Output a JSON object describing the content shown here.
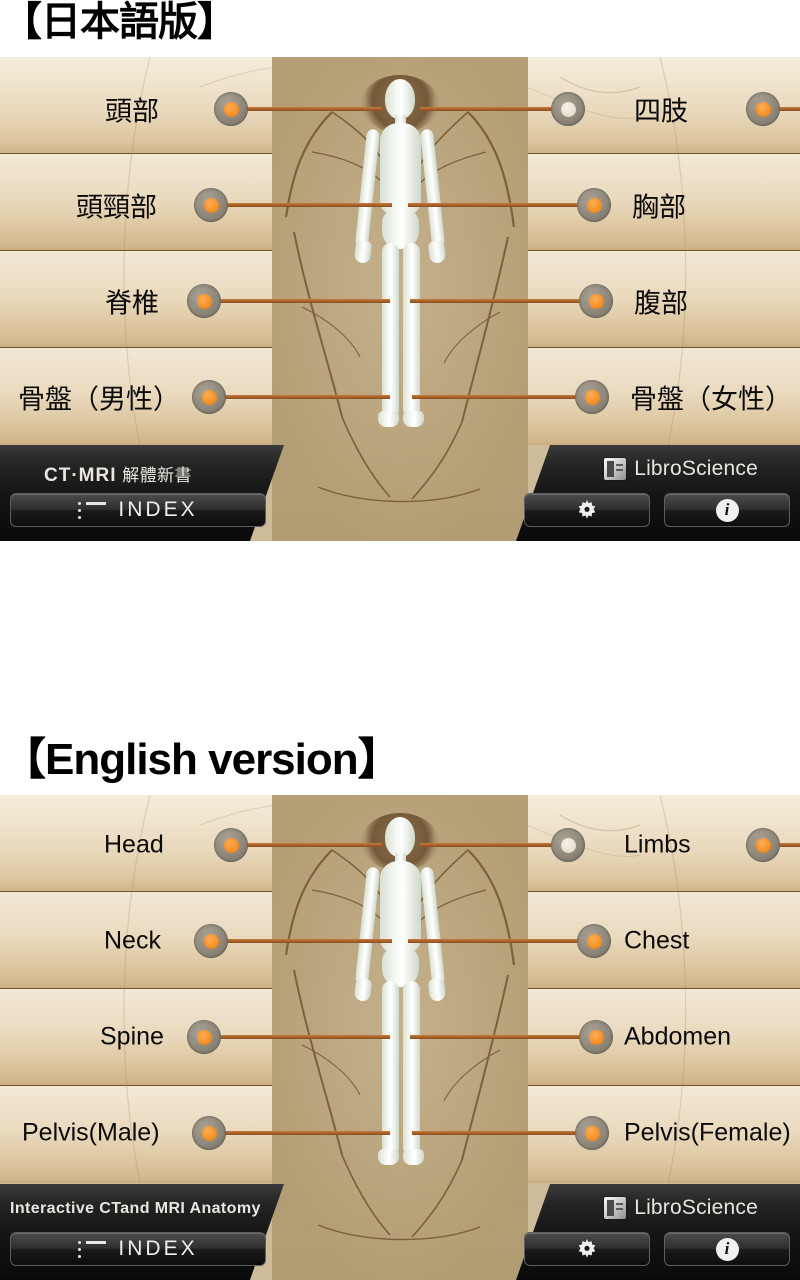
{
  "page": {
    "jp_heading": "【日本語版】",
    "en_heading": "【English version】"
  },
  "app_jp": {
    "language": "Japanese",
    "brand_prefix": "CT·MRI",
    "brand_suffix": "解體新書",
    "publisher": "LibroScience",
    "publisher_icon": "book-icon",
    "index_label": "INDEX",
    "index_icon": "list-icon",
    "settings_icon": "gear-icon",
    "info_icon": "info-icon",
    "left_items": [
      {
        "label": "頭部",
        "region": "head"
      },
      {
        "label": "頭頸部",
        "region": "neck"
      },
      {
        "label": "脊椎",
        "region": "spine"
      },
      {
        "label": "骨盤（男性）",
        "region": "pelvis-male"
      }
    ],
    "right_items": [
      {
        "label": "四肢",
        "region": "limbs"
      },
      {
        "label": "胸部",
        "region": "chest"
      },
      {
        "label": "腹部",
        "region": "abdomen"
      },
      {
        "label": "骨盤（女性）",
        "region": "pelvis-female"
      }
    ]
  },
  "app_en": {
    "language": "English",
    "brand_title": "Interactive CTand MRI Anatomy",
    "publisher": "LibroScience",
    "publisher_icon": "book-icon",
    "index_label": "INDEX",
    "index_icon": "list-icon",
    "settings_icon": "gear-icon",
    "info_icon": "info-icon",
    "left_items": [
      {
        "label": "Head",
        "region": "head"
      },
      {
        "label": "Neck",
        "region": "neck"
      },
      {
        "label": "Spine",
        "region": "spine"
      },
      {
        "label": "Pelvis(Male)",
        "region": "pelvis-male"
      }
    ],
    "right_items": [
      {
        "label": "Limbs",
        "region": "limbs"
      },
      {
        "label": "Chest",
        "region": "chest"
      },
      {
        "label": "Abdomen",
        "region": "abdomen"
      },
      {
        "label": "Pelvis(Female)",
        "region": "pelvis-female"
      }
    ]
  },
  "colors": {
    "accent_dot": "#f28b1e",
    "leader_line": "#a8602a",
    "parchment_light": "#f2e8d5",
    "parchment_dark": "#c9ad80",
    "toolbar_dark": "#111111",
    "text_dark": "#0a0a0a",
    "text_light": "#efefef"
  }
}
